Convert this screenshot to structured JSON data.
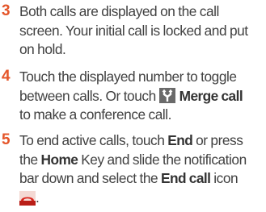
{
  "steps": [
    {
      "number": "3",
      "lines": [
        "Both calls are displayed on the call",
        "screen. Your initial call is locked and put",
        "on hold."
      ]
    },
    {
      "number": "4",
      "line1": "Touch the displayed number to toggle",
      "line2_pre": "between calls. Or touch",
      "merge_label": "Merge call",
      "line3": "to make a conference call."
    },
    {
      "number": "5",
      "line1_pre": "To end active calls, touch",
      "end_label": "End",
      "line1_post": "or press",
      "line2_pre": "the",
      "home_label": "Home",
      "line2_post": "Key and slide the notification",
      "line3_pre": "bar down and select the",
      "end_call_label": "End call",
      "line3_post": "icon",
      "line4_post": "."
    }
  ],
  "icons": {
    "merge": "merge-call-icon",
    "end_call": "end-call-icon"
  },
  "colors": {
    "step_number": "#e4562a",
    "body_text": "#414141",
    "merge_icon_bg": "#6a6a6a",
    "end_icon_red": "#d9241c"
  }
}
